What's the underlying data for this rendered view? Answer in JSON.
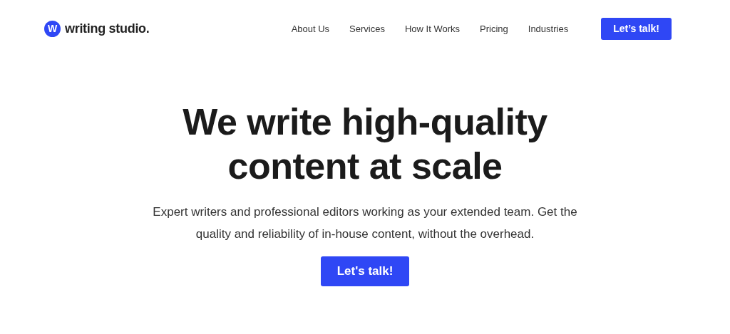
{
  "header": {
    "logo": {
      "mark": "W",
      "name": "writing studio."
    },
    "nav": [
      "About Us",
      "Services",
      "How It Works",
      "Pricing",
      "Industries"
    ],
    "cta": "Let’s talk!"
  },
  "hero": {
    "title": "We write high-quality content at scale",
    "subtitle": "Expert writers and professional editors working as your extended team. Get the quality and reliability of in-house content, without the overhead.",
    "cta": "Let's talk!"
  }
}
